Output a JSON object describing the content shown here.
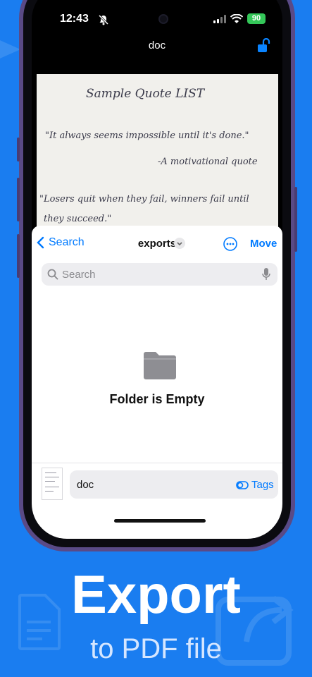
{
  "status_bar": {
    "time": "12:43",
    "battery": "90"
  },
  "viewer": {
    "title": "doc"
  },
  "document_photo": {
    "lines": [
      "Sample Quote LIST",
      "\"It always seems impossible until it's done.\"",
      "-A motivational quote",
      "\"Losers quit when they fail, winners fail until",
      "they succeed.\""
    ]
  },
  "save_sheet": {
    "back_label": "Search",
    "folder_title": "exports",
    "action_label": "Move",
    "search_placeholder": "Search",
    "empty_message": "Folder is Empty",
    "file_name": "doc",
    "tags_label": "Tags"
  },
  "promo": {
    "headline": "Export",
    "subline": "to PDF file"
  },
  "colors": {
    "background": "#1a7df0",
    "accent": "#007aff",
    "battery": "#34c759"
  }
}
